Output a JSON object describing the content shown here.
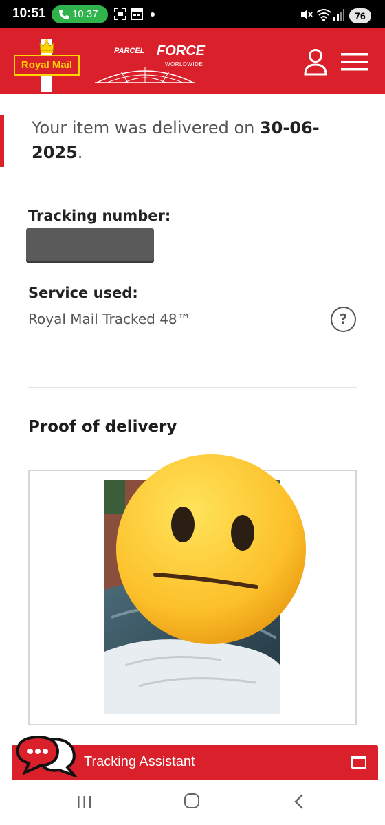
{
  "status_bar": {
    "time": "10:51",
    "call_time": "10:37",
    "battery": "76"
  },
  "header": {
    "brand_royal_mail": "Royal Mail",
    "brand_parcelforce_top": "PARCEL",
    "brand_parcelforce_main": "FORCE",
    "brand_parcelforce_sub": "WORLDWIDE",
    "accent_color": "#da202a"
  },
  "delivery": {
    "message_prefix": "Your item was delivered on ",
    "date": "30-06-2025",
    "message_suffix": "."
  },
  "tracking": {
    "label": "Tracking number:"
  },
  "service": {
    "label": "Service used:",
    "value": "Royal Mail Tracked 48™"
  },
  "proof": {
    "title": "Proof of delivery"
  },
  "assistant": {
    "label": "Tracking Assistant"
  },
  "icons": [
    "call-icon",
    "user-icon",
    "menu-icon",
    "help-icon",
    "chat-icon",
    "window-icon",
    "recents-icon",
    "home-icon",
    "back-icon"
  ]
}
